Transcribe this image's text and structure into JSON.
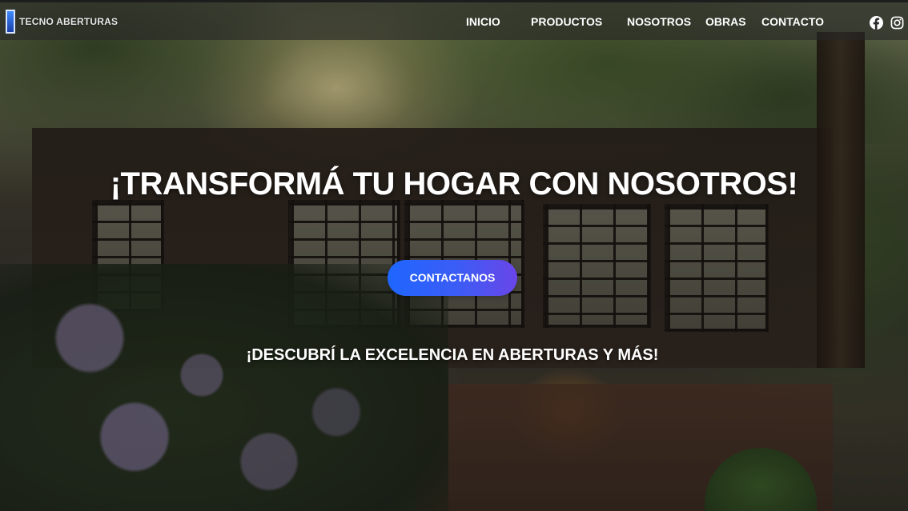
{
  "brand": {
    "logo_text": "TECNO ABERTURAS",
    "accent_color": "#1e66ff"
  },
  "nav": {
    "items": [
      {
        "label": "INICIO"
      },
      {
        "label": "PRODUCTOS"
      },
      {
        "label": "NOSOTROS"
      },
      {
        "label": "OBRAS"
      },
      {
        "label": "CONTACTO"
      }
    ],
    "social": [
      "facebook-icon",
      "instagram-icon"
    ]
  },
  "hero": {
    "title": "¡TRANSFORMÁ TU HOGAR CON NOSOTROS!",
    "cta_label": "CONTACTANOS",
    "subtitle": "¡DESCUBRÍ LA EXCELENCIA EN ABERTURAS Y MÁS!",
    "button_gradient": [
      "#1e66ff",
      "#6a45e8"
    ]
  }
}
